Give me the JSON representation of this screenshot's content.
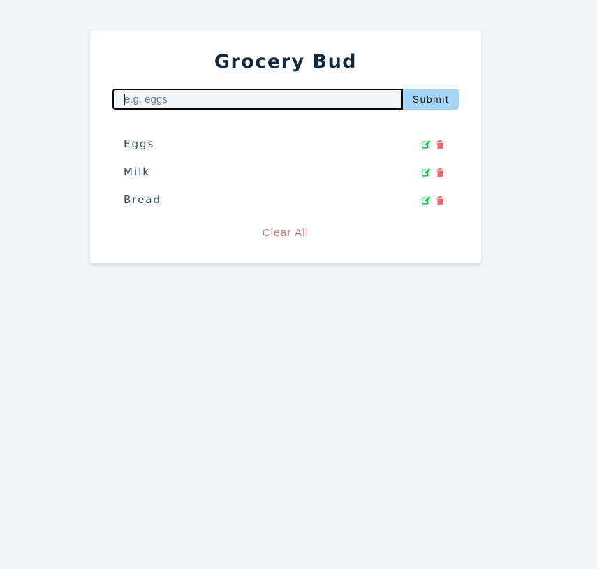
{
  "app": {
    "title": "Grocery Bud"
  },
  "form": {
    "input_value": "",
    "input_placeholder": "e.g. eggs",
    "submit_label": "Submit"
  },
  "items": [
    {
      "name": "Eggs",
      "edit_icon": "edit-icon",
      "delete_icon": "trash-icon"
    },
    {
      "name": "Milk",
      "edit_icon": "edit-icon",
      "delete_icon": "trash-icon"
    },
    {
      "name": "Bread",
      "edit_icon": "edit-icon",
      "delete_icon": "trash-icon"
    }
  ],
  "footer": {
    "clear_label": "Clear All"
  },
  "colors": {
    "background": "#f1f5f8",
    "title": "#102a42",
    "submit_bg": "#a5d5f8",
    "edit": "#22c55e",
    "delete": "#e66b6b",
    "item_text": "#324d67"
  }
}
